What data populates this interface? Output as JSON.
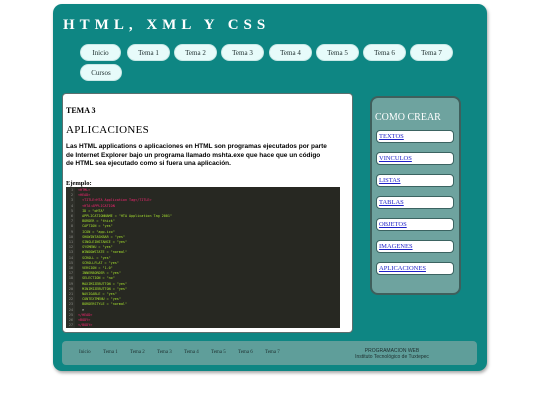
{
  "site": {
    "title": "HTML, XML Y CSS"
  },
  "nav": {
    "tabs": [
      "Inicio",
      "Tema 1",
      "Tema 2",
      "Tema 3",
      "Tema 4",
      "Tema 5",
      "Tema 6",
      "Tema 7",
      "Cursos"
    ]
  },
  "main": {
    "topic_label": "TEMA 3",
    "title": "APLICACIONES",
    "body": "Las HTML applications o aplicaciones en HTML son programas ejecutados por parte de Internet Explorer bajo un programa llamado mshta.exe que hace que un código de HTML sea ejecutado como si fuera una aplicación.",
    "example_label": "Ejemplo:"
  },
  "code": {
    "lines": [
      {
        "n": "1",
        "text": "<HTML>"
      },
      {
        "n": "2",
        "text": "<HEAD>"
      },
      {
        "n": "3",
        "text": "  <TITLE>HTA Application Tag</TITLE>"
      },
      {
        "n": "4",
        "text": "  <HTA:APPLICATION"
      },
      {
        "n": "5",
        "text": "  ID = \"oHTA\""
      },
      {
        "n": "6",
        "text": "  APPLICATIONNAME = \"HTA Application Tag 2001\""
      },
      {
        "n": "7",
        "text": "  BORDER = \"thick\""
      },
      {
        "n": "8",
        "text": "  CAPTION = \"yes\""
      },
      {
        "n": "9",
        "text": "  ICON = \"app.ico\""
      },
      {
        "n": "10",
        "text": "  SHOWINTASKBAR = \"yes\""
      },
      {
        "n": "11",
        "text": "  SINGLEINSTANCE = \"yes\""
      },
      {
        "n": "12",
        "text": "  SYSMENU = \"yes\""
      },
      {
        "n": "13",
        "text": "  WINDOWSTATE = \"normal\""
      },
      {
        "n": "14",
        "text": "  SCROLL = \"yes\""
      },
      {
        "n": "15",
        "text": "  SCROLLFLAT = \"yes\""
      },
      {
        "n": "16",
        "text": "  VERSION = \"1.0\""
      },
      {
        "n": "17",
        "text": "  INNERBORDER = \"yes\""
      },
      {
        "n": "18",
        "text": "  SELECTION = \"no\""
      },
      {
        "n": "19",
        "text": "  MAXIMIZEBUTTON = \"yes\""
      },
      {
        "n": "20",
        "text": "  MINIMIZEBUTTON = \"yes\""
      },
      {
        "n": "21",
        "text": "  NAVIGABLE = \"yes\""
      },
      {
        "n": "22",
        "text": "  CONTEXTMENU = \"yes\""
      },
      {
        "n": "23",
        "text": "  BORDERSTYLE = \"normal\""
      },
      {
        "n": "24",
        "text": "  >"
      },
      {
        "n": "25",
        "text": "</HEAD>"
      },
      {
        "n": "26",
        "text": "<BODY>"
      },
      {
        "n": "27",
        "text": "</BODY>"
      },
      {
        "n": "28",
        "text": "</HTML>"
      }
    ]
  },
  "sidebar": {
    "title": "COMO CREAR",
    "links": [
      "TEXTOS",
      "VINCULOS",
      "LISTAS",
      "TABLAS",
      "OBJETOS",
      "IMAGENES",
      "APLICACIONES"
    ]
  },
  "footer": {
    "links": [
      "Inicio",
      "Tema 1",
      "Tema 2",
      "Tema 3",
      "Tema 4",
      "Tema 5",
      "Tema 6",
      "Tema 7"
    ],
    "org_line1": "PROGRAMACION WEB",
    "org_line2": "Instituto Tecnológico de Tuxtepec"
  },
  "colors": {
    "page_bg": "#0e8683",
    "tab_bg": "#e7fbfa",
    "main_panel_bg": "#ffffff",
    "sidebar_bg": "#6ea39f",
    "footer_bg": "#5f9e9a",
    "link": "#1f22c8",
    "code_bg": "#272822"
  }
}
